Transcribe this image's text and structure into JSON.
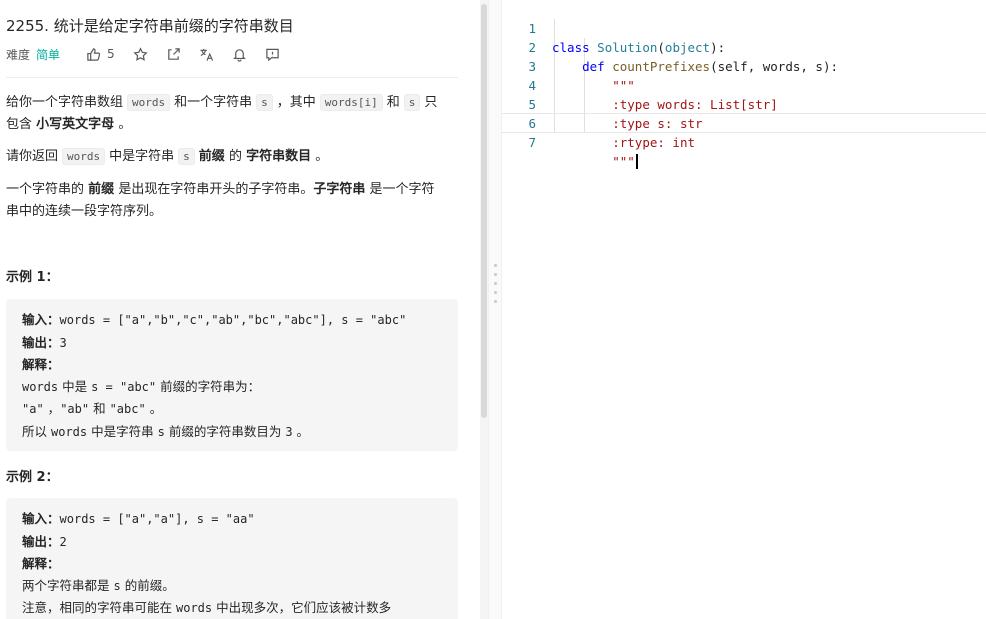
{
  "problem": {
    "title": "2255. 统计是给定字符串前缀的字符串数目",
    "difficulty_label": "难度",
    "difficulty": "简单",
    "likes": "5"
  },
  "icons": {
    "like": "thumbs-up-icon",
    "favorite": "star-icon",
    "share": "share-icon",
    "translate": "translate-icon",
    "notify": "bell-icon",
    "feedback": "comment-icon"
  },
  "description": {
    "p1_a": "给你一个字符串数组",
    "p1_code1": "words",
    "p1_b": "和一个字符串",
    "p1_code2": "s",
    "p1_c": "，其中",
    "p1_code3": "words[i]",
    "p1_d": "和",
    "p1_code4": "s",
    "p1_e": "只",
    "p1_f": "包含",
    "p1_bold": "小写英文字母",
    "p1_g": "。",
    "p2_a": "请你返回",
    "p2_code1": "words",
    "p2_b": "中是字符串",
    "p2_code2": "s",
    "p2_bold1": "前缀",
    "p2_c": "的",
    "p2_bold2": "字符串数目",
    "p2_d": "。",
    "p3_a": "一个字符串的",
    "p3_bold1": "前缀",
    "p3_b": "是出现在字符串开头的子字符串。",
    "p3_bold2": "子字符串",
    "p3_c": "是一个字符",
    "p3_d": "串中的连续一段字符序列。"
  },
  "examples": [
    {
      "title": "示例 1：",
      "input_label": "输入：",
      "input": "words = [\"a\",\"b\",\"c\",\"ab\",\"bc\",\"abc\"], s = \"abc\"",
      "output_label": "输出：",
      "output": "3",
      "explain_label": "解释：",
      "line1_code1": "words",
      "line1_a": "中是",
      "line1_code2": "s = \"abc\"",
      "line1_b": "前缀的字符串为：",
      "line2_code1": "\"a\"",
      "line2_a": "，",
      "line2_code2": "\"ab\"",
      "line2_b": "和",
      "line2_code3": "\"abc\"",
      "line2_c": "。",
      "line3_a": "所以",
      "line3_code1": "words",
      "line3_b": "中是字符串",
      "line3_code2": "s",
      "line3_c": "前缀的字符串数目为",
      "line3_code3": "3",
      "line3_d": "。"
    },
    {
      "title": "示例 2：",
      "input_label": "输入：",
      "input": "words = [\"a\",\"a\"], s = \"aa\"",
      "output_label": "输出：",
      "output": "2",
      "explain_label": "解释：",
      "line1_a": "两个字符串都是",
      "line1_code1": "s",
      "line1_b": "的前缀。",
      "line2_a": "注意，相同的字符串可能在",
      "line2_code1": "words",
      "line2_b": "中出现多次，它们应该被计数多"
    }
  ],
  "editor": {
    "line_numbers": [
      "1",
      "2",
      "3",
      "4",
      "5",
      "6",
      "7"
    ],
    "l1_kw": "class",
    "l1_cls": "Solution",
    "l1_paren_open": "(",
    "l1_base": "object",
    "l1_paren_close": "):",
    "l2_kw": "def",
    "l2_fn": "countPrefixes",
    "l2_params": "(self, words, s):",
    "l3": "\"\"\"",
    "l4": ":type words: List[str]",
    "l5": ":type s: str",
    "l6": ":rtype: int",
    "l7": "\"\"\""
  }
}
